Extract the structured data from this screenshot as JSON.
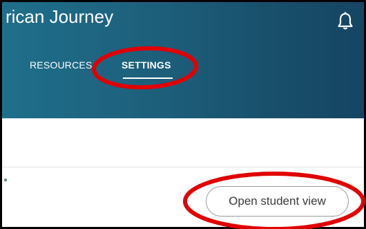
{
  "header": {
    "course_title": "rican Journey",
    "tabs": [
      {
        "label": "RESOURCES",
        "active": false
      },
      {
        "label": "SETTINGS",
        "active": true
      }
    ],
    "notification_icon": "bell-icon"
  },
  "actions": {
    "open_student_view_label": "Open student view"
  },
  "colors": {
    "header_start": "#1f6f8b",
    "header_end": "#154563",
    "annotation_red": "#e00000"
  }
}
